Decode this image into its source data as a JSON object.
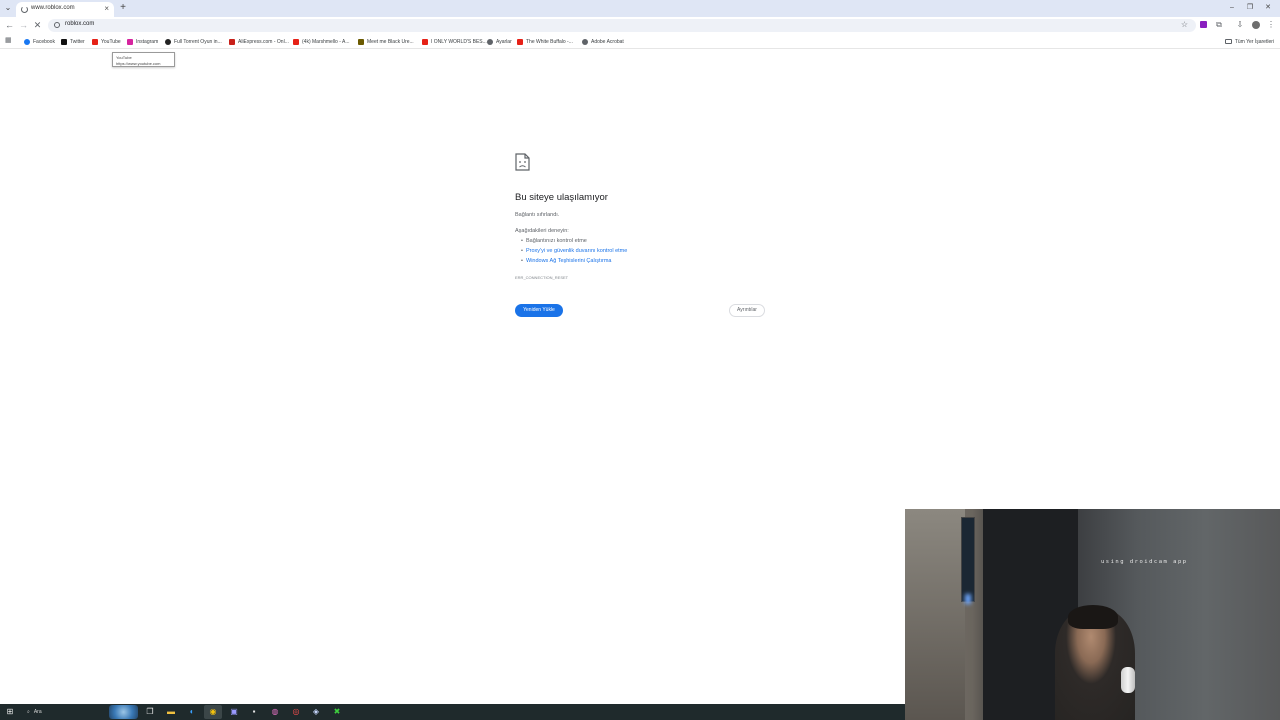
{
  "browser": {
    "tab": {
      "title": "www.roblox.com",
      "close_icon": "×"
    },
    "window_controls": {
      "minimize": "–",
      "restore": "❐",
      "close": "✕"
    },
    "address": {
      "url": "roblox.com"
    }
  },
  "bookmarks": {
    "items": [
      {
        "label": "Facebook",
        "color": "#1877f2"
      },
      {
        "label": "Twitter",
        "color": "#111111"
      },
      {
        "label": "YouTube",
        "color": "#e62117"
      },
      {
        "label": "Instagram",
        "color": "#d6249f"
      },
      {
        "label": "Full Torrent Oyun in...",
        "color": "#222222"
      },
      {
        "label": "AliExpress.com - Onl...",
        "color": "#c8201a"
      },
      {
        "label": "(4k) Marshmello - A...",
        "color": "#e62117"
      },
      {
        "label": "Meet me Black Ure...",
        "color": "#6b5a00"
      },
      {
        "label": "I ONLY WORLD'S BES...",
        "color": "#e62117"
      },
      {
        "label": "Ayarlar",
        "color": "#5f6368"
      },
      {
        "label": "The White Buffalo -...",
        "color": "#e62117"
      },
      {
        "label": "Adobe Acrobat",
        "color": "#5f6368"
      }
    ],
    "all_bookmarks": "Tüm Yer İşaretleri"
  },
  "tooltip": {
    "title": "YouTube",
    "url": "https://www.youtube.com"
  },
  "error_page": {
    "title": "Bu siteye ulaşılamıyor",
    "subtitle": "Bağlantı sıfırlandı.",
    "try_heading": "Aşağıdakileri deneyin:",
    "suggestions": [
      "Bağlantınızı kontrol etme",
      "Proxy'yi ve güvenlik duvarını kontrol etme",
      "Windows Ağ Teşhislerini Çalıştırma"
    ],
    "error_code": "ERR_CONNECTION_RESET",
    "reload_button": "Yeniden Yükle",
    "details_button": "Ayrıntılar"
  },
  "webcam": {
    "overlay_text": "using droidcam app"
  },
  "taskbar": {
    "search_placeholder": "Ara"
  },
  "colors": {
    "accent": "#1a73e8",
    "tabstrip": "#dfe6f5",
    "taskbar": "#1f2a2c"
  }
}
